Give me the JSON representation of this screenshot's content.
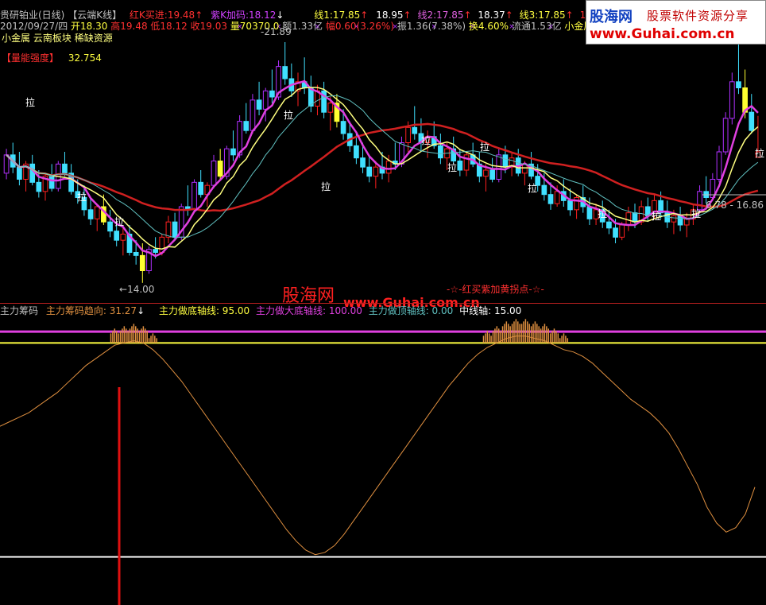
{
  "colors": {
    "bg": "#000000",
    "up": "#ff2020",
    "down": "#40e0ff",
    "purple_k": "#b030ff",
    "yellow_k": "#ffff30",
    "white": "#ffffff",
    "ma_red": "#d02020",
    "ma_magenta": "#e040e0",
    "ma_yellow": "#ffff80",
    "ma_cyan": "#60c0c0",
    "chip_line": "#e09040",
    "axis_magenta": "#e040e0",
    "axis_yellow": "#ffff40",
    "axis_white": "#ffffff",
    "signal_red": "#e01010",
    "wm_red": "#ff2020"
  },
  "header": {
    "stock": "贵研铂业(日线)",
    "tag": "【云端K线】",
    "red_k_label": "红K买进:",
    "red_k_value": "19.48",
    "purple_k_label": "紫K加码:",
    "purple_k_value": "18.12",
    "line1": "线1:17.85",
    "line1b": "18.95",
    "line2": "线2:17.85",
    "line2b": "18.37",
    "line3": "线3:17.85",
    "line3b": "17.65",
    "date": "2012/09/27/四",
    "open": "开18.30",
    "high": "高19.48",
    "low": "低18.12",
    "close": "收19.03",
    "volume": "量70370.0",
    "amount": "额1.33亿",
    "change": "幅0.60(3.26%)",
    "amplitude": "振1.36(7.38%)",
    "turnover": "换4.60%",
    "float": "流通1.53亿",
    "sector": "小金属",
    "sector2": "小金属",
    "board": "云南板块",
    "resource": "稀缺资源",
    "strength_label": "【量能强度】",
    "strength_value": "32.754"
  },
  "annotations": {
    "high_price": "21.89",
    "low_price": "14.00",
    "range": "6.78 - 16.86",
    "pull": "拉",
    "buy_point": "-☆-红买紫加黄拐点-☆-"
  },
  "sub_header": {
    "name": "主力筹码",
    "trend": "主力筹码趋向: 31.27",
    "bottom_axis": "主力做底轴线: 95.00",
    "big_bottom_axis": "主力做大底轴线: 100.00",
    "top_axis": "主力做顶轴线: 0.00",
    "mid_axis": "中线轴: 15.00"
  },
  "watermark": {
    "site": "股海网",
    "url": "www.Guhai.com.cn",
    "logo_name": "股海网",
    "logo_cn": "股票软件资源分享",
    "logo_url": "www.Guhai.com.cn"
  },
  "chart_data": [
    {
      "type": "candlestick",
      "description_free": true,
      "ylim": [
        13.5,
        22.5
      ],
      "candles": [
        [
          17.6,
          18.4,
          17.4,
          18.2
        ],
        [
          18.2,
          18.6,
          17.6,
          17.8
        ],
        [
          17.8,
          18.3,
          17.2,
          17.4
        ],
        [
          17.4,
          18.0,
          17.0,
          17.9
        ],
        [
          17.9,
          18.2,
          17.2,
          17.3
        ],
        [
          17.3,
          17.7,
          16.8,
          17.0
        ],
        [
          17.0,
          17.6,
          16.7,
          17.5
        ],
        [
          17.5,
          17.9,
          17.0,
          17.1
        ],
        [
          17.1,
          18.0,
          17.0,
          17.9
        ],
        [
          17.9,
          18.3,
          17.5,
          17.6
        ],
        [
          17.6,
          17.9,
          16.9,
          17.0
        ],
        [
          17.0,
          17.4,
          16.6,
          16.8
        ],
        [
          16.8,
          17.2,
          16.2,
          16.4
        ],
        [
          16.4,
          16.8,
          15.9,
          16.1
        ],
        [
          16.1,
          16.6,
          15.7,
          16.5
        ],
        [
          16.5,
          16.9,
          15.9,
          16.0
        ],
        [
          16.0,
          16.4,
          15.5,
          15.7
        ],
        [
          15.7,
          16.0,
          15.2,
          15.4
        ],
        [
          15.4,
          15.8,
          14.9,
          15.6
        ],
        [
          15.6,
          15.9,
          14.9,
          15.0
        ],
        [
          15.0,
          15.4,
          14.6,
          14.9
        ],
        [
          14.9,
          15.3,
          14.0,
          14.4
        ],
        [
          14.4,
          15.2,
          14.3,
          15.1
        ],
        [
          15.1,
          15.5,
          14.8,
          15.0
        ],
        [
          15.0,
          15.6,
          14.9,
          15.5
        ],
        [
          15.5,
          16.2,
          15.3,
          16.0
        ],
        [
          16.0,
          16.3,
          15.4,
          15.5
        ],
        [
          15.5,
          16.6,
          15.4,
          16.5
        ],
        [
          16.5,
          17.2,
          16.2,
          16.4
        ],
        [
          16.4,
          17.4,
          16.3,
          17.3
        ],
        [
          17.3,
          17.7,
          16.8,
          16.9
        ],
        [
          16.9,
          17.3,
          16.5,
          17.2
        ],
        [
          17.2,
          18.2,
          17.1,
          18.0
        ],
        [
          18.0,
          18.4,
          17.4,
          17.5
        ],
        [
          17.5,
          18.5,
          17.4,
          18.4
        ],
        [
          18.4,
          19.0,
          18.0,
          18.2
        ],
        [
          18.2,
          19.5,
          18.1,
          19.3
        ],
        [
          19.3,
          19.9,
          18.9,
          19.0
        ],
        [
          19.0,
          20.2,
          18.9,
          20.0
        ],
        [
          20.0,
          20.6,
          19.5,
          19.7
        ],
        [
          19.7,
          20.4,
          19.3,
          20.3
        ],
        [
          20.3,
          21.0,
          19.9,
          20.1
        ],
        [
          20.1,
          21.3,
          20.0,
          21.1
        ],
        [
          21.1,
          21.9,
          20.5,
          20.7
        ],
        [
          20.7,
          21.2,
          20.1,
          20.3
        ],
        [
          20.3,
          20.9,
          19.8,
          20.6
        ],
        [
          20.6,
          21.4,
          20.2,
          20.4
        ],
        [
          20.4,
          20.8,
          19.6,
          19.8
        ],
        [
          19.8,
          20.5,
          19.5,
          20.3
        ],
        [
          20.3,
          20.6,
          19.4,
          19.6
        ],
        [
          19.6,
          20.1,
          19.0,
          19.9
        ],
        [
          19.9,
          20.2,
          19.1,
          19.3
        ],
        [
          19.3,
          19.7,
          18.7,
          18.9
        ],
        [
          18.9,
          19.3,
          18.3,
          18.5
        ],
        [
          18.5,
          18.9,
          17.9,
          18.1
        ],
        [
          18.1,
          18.6,
          17.6,
          17.8
        ],
        [
          17.8,
          18.2,
          17.3,
          17.5
        ],
        [
          17.5,
          18.0,
          17.1,
          17.8
        ],
        [
          17.8,
          18.3,
          17.4,
          17.6
        ],
        [
          17.6,
          18.2,
          17.3,
          18.0
        ],
        [
          18.0,
          18.6,
          17.7,
          17.9
        ],
        [
          17.9,
          18.8,
          17.8,
          18.6
        ],
        [
          18.6,
          19.3,
          18.3,
          19.1
        ],
        [
          19.1,
          19.8,
          18.7,
          18.9
        ],
        [
          18.9,
          19.4,
          18.3,
          18.6
        ],
        [
          18.6,
          19.0,
          18.1,
          18.8
        ],
        [
          18.8,
          19.3,
          18.4,
          18.5
        ],
        [
          18.5,
          18.9,
          17.9,
          18.1
        ],
        [
          18.1,
          18.6,
          17.7,
          18.4
        ],
        [
          18.4,
          18.8,
          17.9,
          18.0
        ],
        [
          18.0,
          18.4,
          17.5,
          17.7
        ],
        [
          17.7,
          18.3,
          17.5,
          18.2
        ],
        [
          18.2,
          18.6,
          17.8,
          17.9
        ],
        [
          17.9,
          18.3,
          17.3,
          17.5
        ],
        [
          17.5,
          17.9,
          17.0,
          17.7
        ],
        [
          17.7,
          18.1,
          17.3,
          17.4
        ],
        [
          17.4,
          18.4,
          17.3,
          18.2
        ],
        [
          18.2,
          18.5,
          17.6,
          17.8
        ],
        [
          17.8,
          18.3,
          17.5,
          18.1
        ],
        [
          18.1,
          18.4,
          17.5,
          17.6
        ],
        [
          17.6,
          18.0,
          17.2,
          17.9
        ],
        [
          17.9,
          18.3,
          17.4,
          17.5
        ],
        [
          17.5,
          17.9,
          17.0,
          17.2
        ],
        [
          17.2,
          17.6,
          16.7,
          16.9
        ],
        [
          16.9,
          17.3,
          16.4,
          16.6
        ],
        [
          16.6,
          17.2,
          16.5,
          17.0
        ],
        [
          17.0,
          17.4,
          16.5,
          16.7
        ],
        [
          16.7,
          17.1,
          16.2,
          16.4
        ],
        [
          16.4,
          16.9,
          16.1,
          16.8
        ],
        [
          16.8,
          17.2,
          16.3,
          16.5
        ],
        [
          16.5,
          16.8,
          15.9,
          16.1
        ],
        [
          16.1,
          16.6,
          15.9,
          16.4
        ],
        [
          16.4,
          16.7,
          15.8,
          16.0
        ],
        [
          16.0,
          16.4,
          15.6,
          15.8
        ],
        [
          15.8,
          16.1,
          15.3,
          15.5
        ],
        [
          15.5,
          16.0,
          15.4,
          15.9
        ],
        [
          15.9,
          16.5,
          15.7,
          16.3
        ],
        [
          16.3,
          16.6,
          15.8,
          16.0
        ],
        [
          16.0,
          16.7,
          15.9,
          16.5
        ],
        [
          16.5,
          16.8,
          16.0,
          16.2
        ],
        [
          16.2,
          16.9,
          16.1,
          16.7
        ],
        [
          16.7,
          17.0,
          16.1,
          16.3
        ],
        [
          16.3,
          16.7,
          15.8,
          16.0
        ],
        [
          16.0,
          16.4,
          15.6,
          16.2
        ],
        [
          16.2,
          16.5,
          15.7,
          15.9
        ],
        [
          15.9,
          16.3,
          15.5,
          16.1
        ],
        [
          16.1,
          16.6,
          15.9,
          16.4
        ],
        [
          16.4,
          17.2,
          16.3,
          17.0
        ],
        [
          17.0,
          17.5,
          16.6,
          16.8
        ],
        [
          16.8,
          17.6,
          16.7,
          17.4
        ],
        [
          17.4,
          18.5,
          17.3,
          18.3
        ],
        [
          18.3,
          19.6,
          18.2,
          19.4
        ],
        [
          19.4,
          20.9,
          19.2,
          20.6
        ],
        [
          20.6,
          21.9,
          20.2,
          20.4
        ],
        [
          20.4,
          21.0,
          19.4,
          19.6
        ],
        [
          19.6,
          20.2,
          18.9,
          19.0
        ],
        [
          18.12,
          19.48,
          18.12,
          18.3
        ]
      ]
    },
    {
      "type": "line",
      "name": "主力筹码趋向",
      "ylim": [
        -15,
        105
      ],
      "values": [
        58,
        60,
        62,
        64,
        67,
        70,
        73,
        77,
        81,
        85,
        88,
        91,
        94,
        95,
        96,
        95,
        92,
        88,
        83,
        78,
        72,
        66,
        60,
        54,
        48,
        42,
        36,
        30,
        24,
        18,
        12,
        7,
        3,
        1,
        2,
        5,
        10,
        16,
        22,
        28,
        34,
        40,
        46,
        52,
        58,
        64,
        70,
        76,
        81,
        86,
        90,
        93,
        95,
        97,
        98,
        98,
        97,
        96,
        94,
        92,
        91,
        89,
        86,
        82,
        78,
        74,
        70,
        67,
        64,
        60,
        55,
        48,
        40,
        32,
        22,
        15,
        11,
        13,
        19,
        31
      ]
    }
  ]
}
